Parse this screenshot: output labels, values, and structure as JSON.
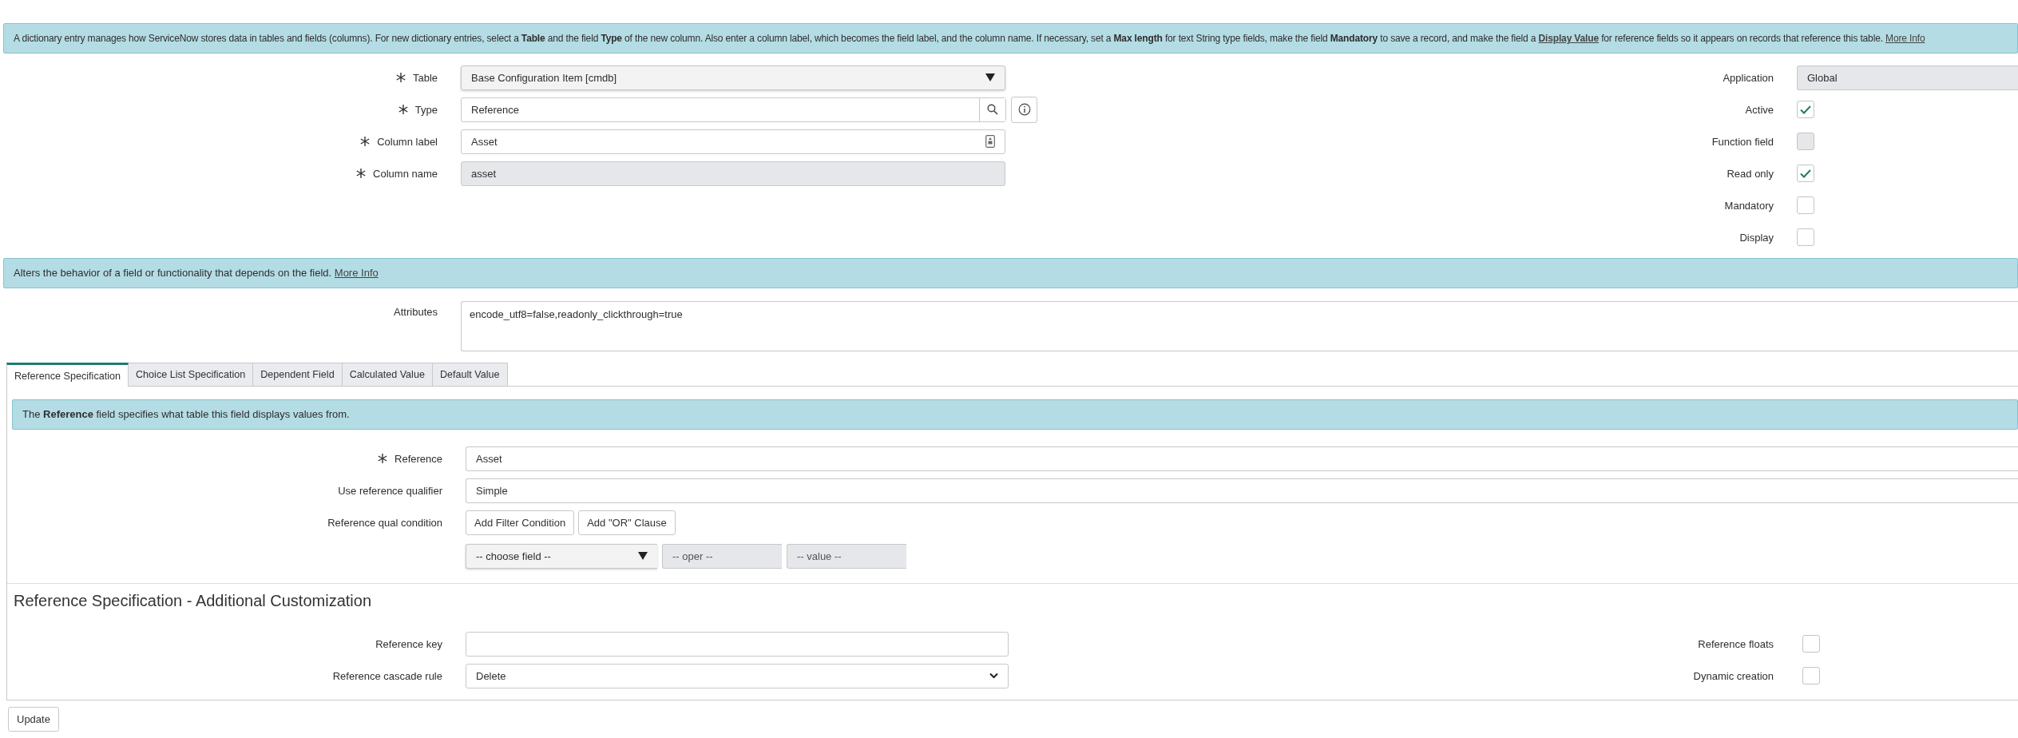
{
  "intro_banner": {
    "segments": [
      {
        "kind": "text",
        "text": "A dictionary entry manages how ServiceNow stores data in tables and fields (columns). For new dictionary entries, select a **Table** and the field **Type** of the new column. Also enter a column label, which becomes the field label, and the column name. If necessary, set a **Max length** for text String type fields, make the field **Mandatory** to save a record, and make the field a "
      },
      {
        "kind": "link",
        "text": "Display Value"
      },
      {
        "kind": "text",
        "text": " for reference fields so it appears on records that reference this table. "
      },
      {
        "kind": "more",
        "text": "More Info"
      }
    ]
  },
  "main_fields": [
    {
      "label": "Table",
      "required": true,
      "kind": "select",
      "value": "Base Configuration Item [cmdb]"
    },
    {
      "label": "Type",
      "required": true,
      "kind": "lookup",
      "value": "Reference"
    },
    {
      "label": "Column label",
      "required": true,
      "kind": "text_icon",
      "value": "Asset"
    },
    {
      "label": "Column name",
      "required": true,
      "kind": "readonly",
      "value": "asset"
    }
  ],
  "side_fields": [
    {
      "label": "Application",
      "kind": "readonly",
      "value": "Global"
    },
    {
      "label": "Active",
      "kind": "checkbox",
      "checked": true,
      "disabled": false
    },
    {
      "label": "Function field",
      "kind": "checkbox",
      "checked": false,
      "disabled": true
    },
    {
      "label": "Read only",
      "kind": "checkbox",
      "checked": true,
      "disabled": false
    },
    {
      "label": "Mandatory",
      "kind": "checkbox",
      "checked": false,
      "disabled": false
    },
    {
      "label": "Display",
      "kind": "checkbox",
      "checked": false,
      "disabled": false
    }
  ],
  "attributes_banner": {
    "segments": [
      {
        "kind": "text",
        "text": "Alters the behavior of a field or functionality that depends on the field. "
      },
      {
        "kind": "more",
        "text": "More Info"
      }
    ]
  },
  "attributes": {
    "label": "Attributes",
    "value": "encode_utf8=false,readonly_clickthrough=true"
  },
  "tabs": [
    {
      "label": "Reference Specification",
      "selected": true
    },
    {
      "label": "Choice List Specification",
      "selected": false
    },
    {
      "label": "Dependent Field",
      "selected": false
    },
    {
      "label": "Calculated Value",
      "selected": false
    },
    {
      "label": "Default Value",
      "selected": false
    }
  ],
  "reference_banner": {
    "segments": [
      {
        "kind": "text",
        "text": "The **Reference** field specifies what table this field displays values from."
      }
    ]
  },
  "reference_fields": [
    {
      "label": "Reference",
      "required": true,
      "kind": "text",
      "value": "Asset"
    },
    {
      "label": "Use reference qualifier",
      "required": false,
      "kind": "readonly_white",
      "value": "Simple"
    },
    {
      "label": "Reference qual condition",
      "required": false,
      "kind": "buttons",
      "buttons": [
        "Add Filter Condition",
        "Add \"OR\" Clause"
      ]
    },
    {
      "kind": "condition",
      "field": "-- choose field --",
      "oper": "-- oper --",
      "value": "-- value --"
    }
  ],
  "customization": {
    "heading": "Reference Specification - Additional Customization",
    "fields": [
      {
        "label": "Reference key",
        "required": false,
        "kind": "text"
      },
      {
        "label": "Reference cascade rule",
        "required": false,
        "kind": "native_select",
        "value": "Delete"
      }
    ],
    "side_fields": [
      {
        "label": "Reference floats",
        "kind": "checkbox",
        "checked": false,
        "disabled": false
      },
      {
        "label": "Dynamic creation",
        "kind": "checkbox",
        "checked": false,
        "disabled": false
      }
    ]
  },
  "update_button": "Update"
}
